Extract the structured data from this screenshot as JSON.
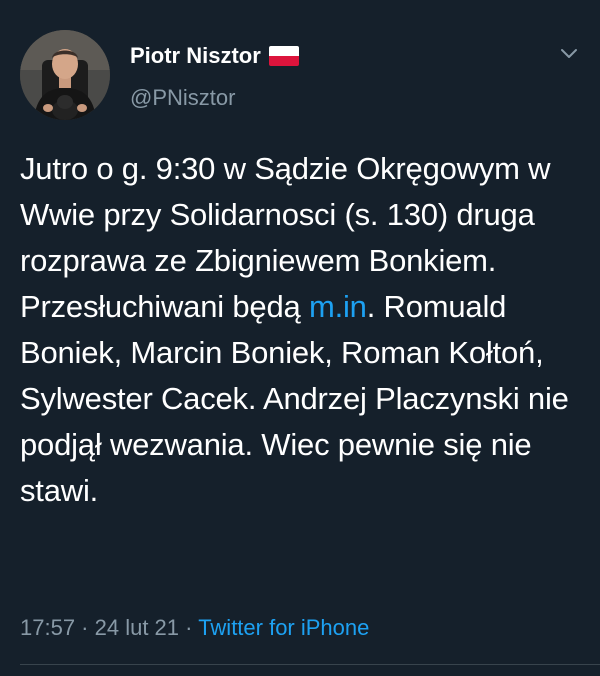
{
  "author": {
    "display_name": "Piotr Nisztor",
    "handle": "@PNisztor",
    "flag_icon": "poland-flag-icon"
  },
  "tweet": {
    "text_before_link": "Jutro o g. 9:30 w Sądzie Okręgowym w Wwie przy Solidarnosci (s. 130) druga rozprawa ze Zbigniewem Bonkiem. Przesłuchiwani będą ",
    "link_text": "m.in",
    "text_after_link": ". Romuald Boniek, Marcin Boniek, Roman Kołtoń, Sylwester Cacek. Andrzej Placzynski nie podjął wezwania. Wiec pewnie się nie stawi."
  },
  "meta": {
    "time": "17:57",
    "separator1": " · ",
    "date": "24 lut 21",
    "separator2": " · ",
    "source": "Twitter for iPhone"
  },
  "colors": {
    "background": "#15202b",
    "text": "#ffffff",
    "secondary": "#8899a6",
    "link": "#1da1f2"
  }
}
